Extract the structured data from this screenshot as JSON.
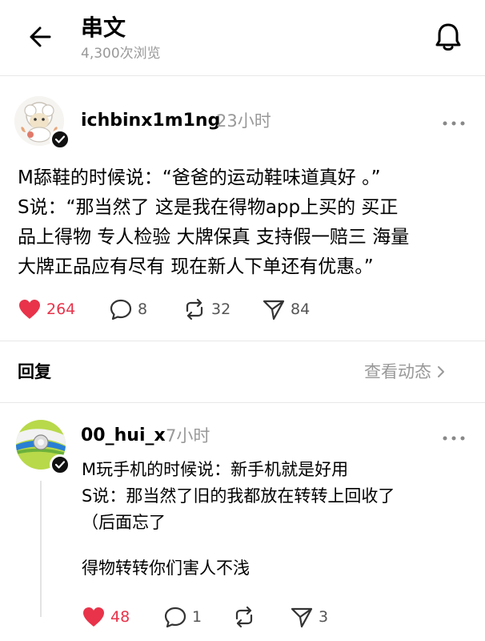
{
  "header": {
    "title": "串文",
    "views": "4,300次浏览"
  },
  "post": {
    "username": "ichbinx1m1ng",
    "time": "23小时",
    "text": "M舔鞋的时候说：“爸爸的运动鞋味道真好 。”\nS说：“那当然了 这是我在得物app上买的  买正\n品上得物 专人检验 大牌保真 支持假一赔三 海量\n大牌正品应有尽有 现在新人下单还有优惠。”",
    "likes": "264",
    "comments": "8",
    "reposts": "32",
    "shares": "84"
  },
  "replies_section": {
    "label": "回复",
    "see_activity": "查看动态"
  },
  "reply": {
    "username": "00_hui_x",
    "time": "7小时",
    "text": "M玩手机的时候说：新手机就是好用\nS说：那当然了旧的我都放在转转上回收了\n（后面忘了",
    "text2": "得物转转你们害人不浅",
    "likes": "48",
    "comments": "1",
    "reposts": "",
    "shares": "3"
  },
  "colors": {
    "like_red": "#e8334a",
    "muted_gray": "#999999"
  },
  "icons": [
    "back-arrow-icon",
    "bell-icon",
    "more-icon",
    "heart-icon",
    "comment-icon",
    "repost-icon",
    "share-icon",
    "chevron-right-icon",
    "verified-check-icon"
  ]
}
